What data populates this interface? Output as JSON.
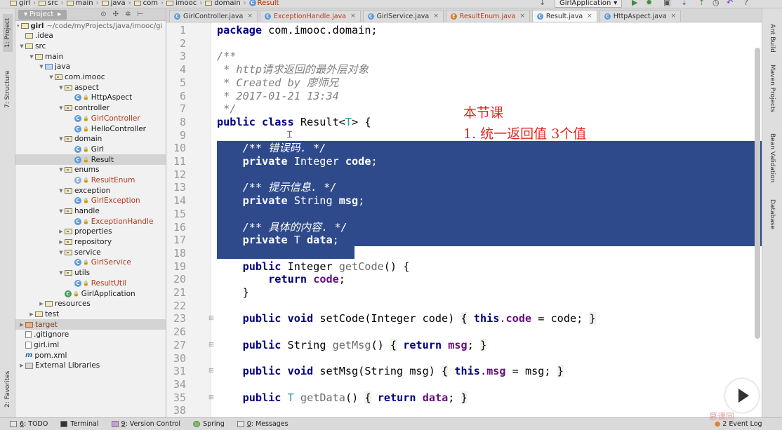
{
  "breadcrumb": [
    "girl",
    "src",
    "main",
    "java",
    "com",
    "imooc",
    "domain",
    "Result"
  ],
  "run_config": "GirlApplication",
  "left_tabs": [
    "1: Project",
    "7: Structure",
    "2: Favorites"
  ],
  "right_tabs": [
    "Ant Build",
    "Maven Projects",
    "Bean Validation",
    "Database"
  ],
  "project": {
    "tab_label": "Project",
    "root_name": "girl",
    "root_path": "~/code/myProjects/java/imooc/gi",
    "tree": [
      {
        "label": "idea",
        "prefix": ".",
        "level": 0,
        "icon": "folder",
        "tri": ""
      },
      {
        "label": "src",
        "level": 0,
        "icon": "folder",
        "tri": "down"
      },
      {
        "label": "main",
        "level": 1,
        "icon": "folder",
        "tri": "down"
      },
      {
        "label": "java",
        "level": 2,
        "icon": "folder-src",
        "tri": "down"
      },
      {
        "label": "com.imooc",
        "level": 3,
        "icon": "package",
        "tri": "down"
      },
      {
        "label": "aspect",
        "level": 4,
        "icon": "package",
        "tri": "down"
      },
      {
        "label": "HttpAspect",
        "level": 5,
        "icon": "class"
      },
      {
        "label": "controller",
        "level": 4,
        "icon": "package",
        "tri": "down"
      },
      {
        "label": "GirlController",
        "level": 5,
        "icon": "class",
        "color": "red"
      },
      {
        "label": "HelloController",
        "level": 5,
        "icon": "class"
      },
      {
        "label": "domain",
        "level": 4,
        "icon": "package",
        "tri": "down"
      },
      {
        "label": "Girl",
        "level": 5,
        "icon": "class"
      },
      {
        "label": "Result",
        "level": 5,
        "icon": "class",
        "selected": true
      },
      {
        "label": "enums",
        "level": 4,
        "icon": "package",
        "tri": "down"
      },
      {
        "label": "ResultEnum",
        "level": 5,
        "icon": "enum",
        "color": "red"
      },
      {
        "label": "exception",
        "level": 4,
        "icon": "package",
        "tri": "down"
      },
      {
        "label": "GirlException",
        "level": 5,
        "icon": "class",
        "color": "red"
      },
      {
        "label": "handle",
        "level": 4,
        "icon": "package",
        "tri": "down"
      },
      {
        "label": "ExceptionHandle",
        "level": 5,
        "icon": "class",
        "color": "red"
      },
      {
        "label": "properties",
        "level": 4,
        "icon": "package",
        "tri": "right"
      },
      {
        "label": "repository",
        "level": 4,
        "icon": "package",
        "tri": "right"
      },
      {
        "label": "service",
        "level": 4,
        "icon": "package",
        "tri": "down"
      },
      {
        "label": "GirlService",
        "level": 5,
        "icon": "class",
        "color": "red"
      },
      {
        "label": "utils",
        "level": 4,
        "icon": "package",
        "tri": "down"
      },
      {
        "label": "ResultUtil",
        "level": 5,
        "icon": "class",
        "color": "red"
      },
      {
        "label": "GirlApplication",
        "level": 4,
        "icon": "app"
      },
      {
        "label": "resources",
        "level": 2,
        "icon": "folder",
        "tri": "right"
      },
      {
        "label": "test",
        "level": 1,
        "icon": "folder",
        "tri": "right"
      },
      {
        "label": "target",
        "level": 0,
        "icon": "folder-excl",
        "tri": "right",
        "color": "brown",
        "selected": true
      },
      {
        "label": "gitignore",
        "prefix": ".",
        "level": 0,
        "icon": "file"
      },
      {
        "label": "girl.iml",
        "level": 0,
        "icon": "file"
      },
      {
        "label": "pom.xml",
        "level": 0,
        "icon": "maven"
      },
      {
        "label": "External Libraries",
        "level": 0,
        "icon": "lib",
        "tri": "right"
      }
    ]
  },
  "editor_tabs": [
    {
      "name": "GirlController.java",
      "icon": "class",
      "red": false
    },
    {
      "name": "ExceptionHandle.java",
      "icon": "class",
      "red": true
    },
    {
      "name": "GirlService.java",
      "icon": "class",
      "red": false
    },
    {
      "name": "ResultEnum.java",
      "icon": "enum",
      "red": true
    },
    {
      "name": "Result.java",
      "icon": "class",
      "red": false,
      "active": true
    },
    {
      "name": "HttpAspect.java",
      "icon": "class",
      "red": false
    }
  ],
  "code_lines": [
    {
      "n": "1",
      "html": "<span class='kw'>package</span> com.imooc.domain;"
    },
    {
      "n": "2",
      "html": ""
    },
    {
      "n": "3",
      "html": "<span class='cm'>/**</span>"
    },
    {
      "n": "4",
      "html": "<span class='doc'> * http请求返回的最外层对象</span>"
    },
    {
      "n": "5",
      "html": "<span class='doc'> * Created by 廖师兄</span>"
    },
    {
      "n": "6",
      "html": "<span class='doc'> * 2017-01-21 13:34</span>"
    },
    {
      "n": "7",
      "html": "<span class='doc'> */</span>"
    },
    {
      "n": "8",
      "html": "<span class='kw'>public class</span> Result&lt;<span class='gen'>T</span>&gt; {"
    },
    {
      "n": "9",
      "html": ""
    },
    {
      "n": "10",
      "html": "    <span class='cm'>/** 错误码. */</span>",
      "sel": true
    },
    {
      "n": "11",
      "html": "    <span class='kw'>private</span> Integer <span class='fld'>code</span>;",
      "sel": true
    },
    {
      "n": "12",
      "html": "",
      "sel": true
    },
    {
      "n": "13",
      "html": "    <span class='cm'>/** 提示信息. */</span>",
      "sel": true
    },
    {
      "n": "14",
      "html": "    <span class='kw'>private</span> String <span class='fld'>msg</span>;",
      "sel": true
    },
    {
      "n": "15",
      "html": "",
      "sel": true
    },
    {
      "n": "16",
      "html": "    <span class='cm'>/** 具体的内容. */</span>",
      "sel": true
    },
    {
      "n": "17",
      "html": "    <span class='kw'>private</span> T <span class='fld'>data</span>;",
      "sel": true
    },
    {
      "n": "18",
      "html": ""
    },
    {
      "n": "19",
      "html": "    <span class='kw'>public</span> Integer <span class='mth'>getCode</span>() {"
    },
    {
      "n": "20",
      "html": "        <span class='kw'>return</span> <span class='fld'>code</span>;"
    },
    {
      "n": "21",
      "html": "    }"
    },
    {
      "n": "22",
      "html": ""
    },
    {
      "n": "23",
      "html": "    <span class='kw'>public void</span> setCode(Integer code) <span class='fold-bg'>{</span> <span class='kw'>this</span>.<span class='fld'>code</span> = code; <span class='fold-bg'>}</span>",
      "fold": true
    },
    {
      "n": "26",
      "html": ""
    },
    {
      "n": "27",
      "html": "    <span class='kw'>public</span> String <span class='mth'>getMsg</span>() <span class='fold-bg'>{</span> <span class='kw'>return</span> <span class='fld'>msg</span>; <span class='fold-bg'>}</span>",
      "fold": true
    },
    {
      "n": "30",
      "html": ""
    },
    {
      "n": "31",
      "html": "    <span class='kw'>public void</span> setMsg(String msg) <span class='fold-bg'>{</span> <span class='kw'>this</span>.<span class='fld'>msg</span> = msg; <span class='fold-bg'>}</span>",
      "fold": true
    },
    {
      "n": "34",
      "html": ""
    },
    {
      "n": "35",
      "html": "    <span class='kw'>public</span> <span class='gen'>T</span> <span class='mth'>getData</span>() <span class='fold-bg'>{</span> <span class='kw'>return</span> <span class='fld'>data</span>; <span class='fold-bg'>}</span>",
      "fold": true
    },
    {
      "n": "38",
      "html": ""
    }
  ],
  "annotation": {
    "line1": "本节课",
    "line2": "1. 统一返回值   3个值"
  },
  "status_tabs": [
    {
      "num": "6",
      "label": ": TODO"
    },
    {
      "num": "",
      "label": "Terminal"
    },
    {
      "num": "9",
      "label": ": Version Control"
    },
    {
      "num": "",
      "label": "Spring"
    },
    {
      "num": "0",
      "label": ": Messages"
    }
  ],
  "event_log": {
    "num": "2",
    "label": "Event Log"
  },
  "watermark": "慕课网"
}
